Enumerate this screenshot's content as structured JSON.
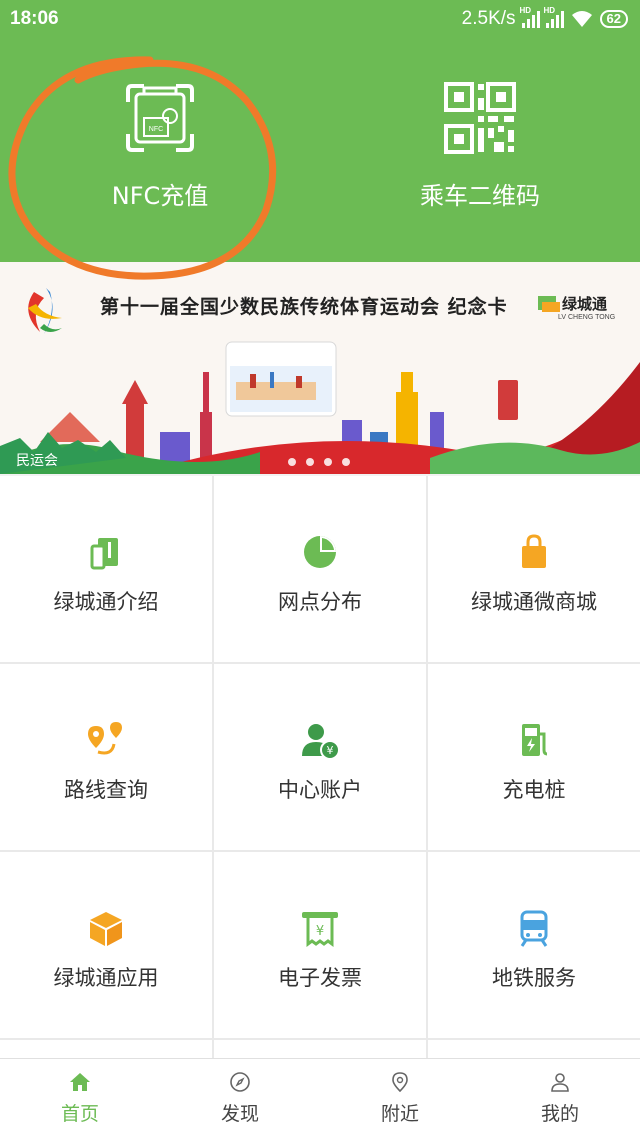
{
  "status": {
    "time": "18:06",
    "net_speed": "2.5K/s",
    "battery": "62"
  },
  "quick_actions": {
    "nfc_label": "NFC充值",
    "nfc_icon_text": "NFC",
    "qr_label": "乘车二维码"
  },
  "banner": {
    "title": "第十一届全国少数民族传统体育运动会 纪念卡",
    "brand": "绿城通",
    "brand_sub": "LV CHENG TONG",
    "caption": "民运会",
    "slide_count": 4
  },
  "services": [
    {
      "label": "绿城通介绍",
      "icon": "card-intro-icon",
      "color": "#6cbb54"
    },
    {
      "label": "网点分布",
      "icon": "pie-chart-icon",
      "color": "#6cbb54"
    },
    {
      "label": "绿城通微商城",
      "icon": "shopping-bag-icon",
      "color": "#f5a623"
    },
    {
      "label": "路线查询",
      "icon": "route-icon",
      "color": "#f5a623"
    },
    {
      "label": "中心账户",
      "icon": "account-icon",
      "color": "#3e9a4a"
    },
    {
      "label": "充电桩",
      "icon": "charging-pile-icon",
      "color": "#6cbb54"
    },
    {
      "label": "绿城通应用",
      "icon": "box-icon",
      "color": "#f5a623"
    },
    {
      "label": "电子发票",
      "icon": "invoice-icon",
      "color": "#6cbb54"
    },
    {
      "label": "地铁服务",
      "icon": "subway-icon",
      "color": "#4aa3df"
    }
  ],
  "bottom_nav": [
    {
      "label": "首页",
      "icon": "home-icon",
      "active": true
    },
    {
      "label": "发现",
      "icon": "compass-icon",
      "active": false
    },
    {
      "label": "附近",
      "icon": "location-icon",
      "active": false
    },
    {
      "label": "我的",
      "icon": "user-icon",
      "active": false
    }
  ],
  "colors": {
    "primary": "#6cbb54",
    "orange": "#f5a623",
    "annotation": "#f07a2a"
  }
}
